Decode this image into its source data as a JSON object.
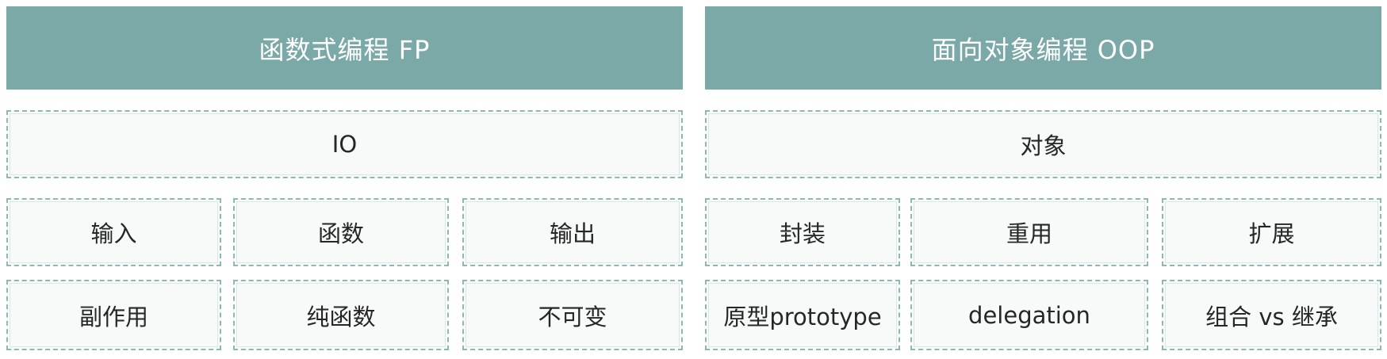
{
  "fp": {
    "header": "函数式编程 FP",
    "io": "IO",
    "row1": [
      "输入",
      "函数",
      "输出"
    ],
    "row2": [
      "副作用",
      "纯函数",
      "不可变"
    ]
  },
  "oop": {
    "header": "面向对象编程 OOP",
    "object": "对象",
    "row1": [
      "封装",
      "重用",
      "扩展"
    ],
    "row2": [
      "原型prototype",
      "delegation",
      "组合 vs 继承"
    ]
  },
  "colors": {
    "header_bg": "#7aa9a7",
    "header_text": "#ffffff",
    "cell_border": "#8fb8b5",
    "cell_bg": "#f7faf9"
  }
}
